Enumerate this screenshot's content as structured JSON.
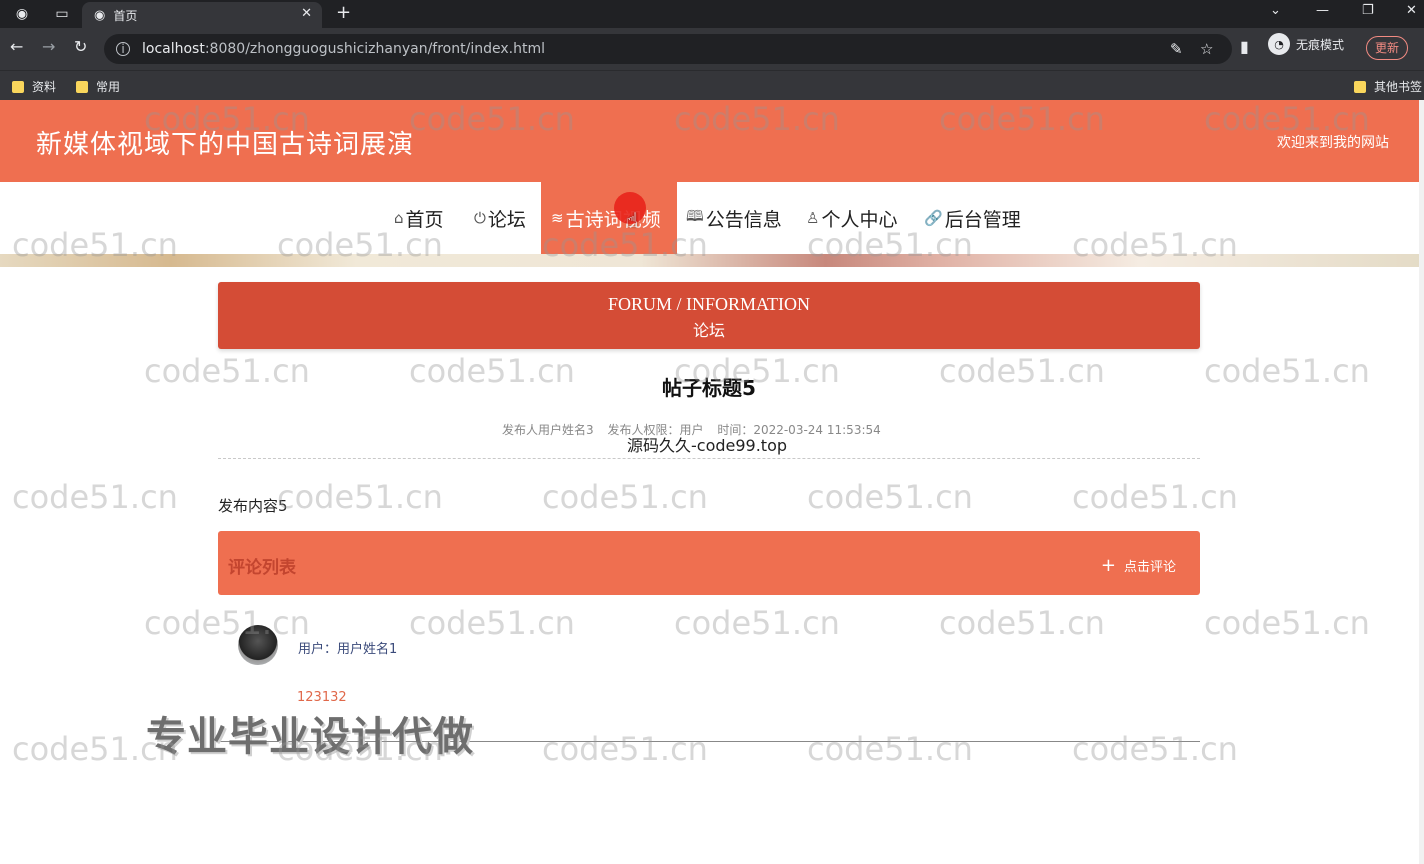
{
  "browser": {
    "tab_title": "首页",
    "url_host": "localhost",
    "url_rest": ":8080/zhongguogushicizhanyan/front/index.html",
    "profile_label": "无痕模式",
    "update_label": "更新",
    "bookmarks": [
      "资料",
      "常用"
    ],
    "other_bookmarks": "其他书签"
  },
  "site": {
    "title": "新媒体视域下的中国古诗词展演",
    "welcome": "欢迎来到我的网站"
  },
  "nav": {
    "items": [
      {
        "icon": "home-icon",
        "glyph": "⌂",
        "label": "首页"
      },
      {
        "icon": "power-icon",
        "glyph": "⏻",
        "label": "论坛"
      },
      {
        "icon": "layers-icon",
        "glyph": "≋",
        "label": "古诗词视频"
      },
      {
        "icon": "book-icon",
        "glyph": "🕮",
        "label": "公告信息"
      },
      {
        "icon": "user-icon",
        "glyph": "♙",
        "label": "个人中心"
      },
      {
        "icon": "link-icon",
        "glyph": "🔗",
        "label": "后台管理"
      }
    ]
  },
  "forum": {
    "heading_en": "FORUM / INFORMATION",
    "heading_cn": "论坛"
  },
  "post": {
    "title": "帖子标题5",
    "publisher": "发布人用户姓名3",
    "permission": "发布人权限：用户",
    "time": "时间：2022-03-24 11:53:54",
    "content": "发布内容5"
  },
  "comments": {
    "title": "评论列表",
    "add_label": "点击评论",
    "items": [
      {
        "user": "用户：用户姓名1",
        "text": "123132"
      }
    ]
  },
  "overlays": {
    "source": "源码久久-code99.top",
    "ad": "专业毕业设计代做",
    "watermark": "code51.cn"
  }
}
